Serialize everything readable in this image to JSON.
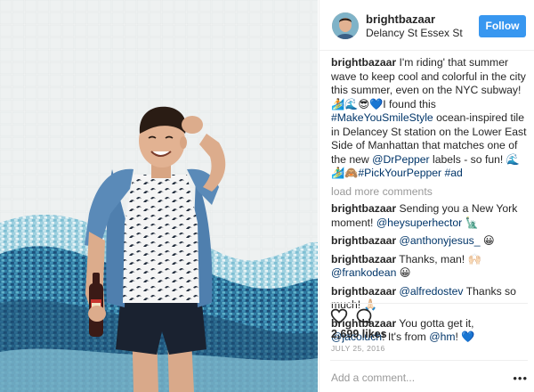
{
  "post": {
    "username": "brightbazaar",
    "location": "Delancy St Essex St",
    "follow_label": "Follow"
  },
  "caption": {
    "username": "brightbazaar",
    "text_1": "I'm riding' that summer wave to keep cool and colorful in the city this summer, even on the NYC subway! 🏄🌊😎💙I found this ",
    "hashtag_1": "#MakeYouSmileStyle",
    "text_2": " ocean-inspired tile in Delancey St station on the Lower East Side of Manhattan that matches one of the new ",
    "mention_1": "@DrPepper",
    "text_3": " labels - so fun! 🌊🏄‍♂️🙈",
    "hashtag_2": "#PickYourPepper",
    "space": " ",
    "hashtag_3": "#ad"
  },
  "load_more": "load more comments",
  "comments": [
    {
      "username": "brightbazaar",
      "text": " Sending you a New York moment! ",
      "mention": "@heysuperhector",
      "tail": " 🗽"
    },
    {
      "username": "brightbazaar",
      "text": " ",
      "mention": "@anthonyjesus_",
      "tail": " 😀"
    },
    {
      "username": "brightbazaar",
      "text": " Thanks, man! 🙌🏻 ",
      "mention": "@frankodean",
      "tail": " 😀"
    },
    {
      "username": "brightbazaar",
      "text": " ",
      "mention": "@alfredostev",
      "tail": " Thanks so much! 🙏🏻"
    },
    {
      "username": "brightbazaar",
      "text": " You gotta get it, ",
      "mention": "@jacoluch",
      "tail": "! It's from ",
      "mention2": "@hm",
      "tail2": "! 💙"
    }
  ],
  "likes": "2,699 likes",
  "date": "JULY 25, 2016",
  "add_comment_placeholder": "Add a comment...",
  "more_options": "•••",
  "icons": {
    "like": "heart-icon",
    "comment": "comment-bubble-icon",
    "more": "more-options-icon"
  },
  "colors": {
    "follow_button": "#3897f0",
    "link": "#003569",
    "muted": "#999999"
  }
}
